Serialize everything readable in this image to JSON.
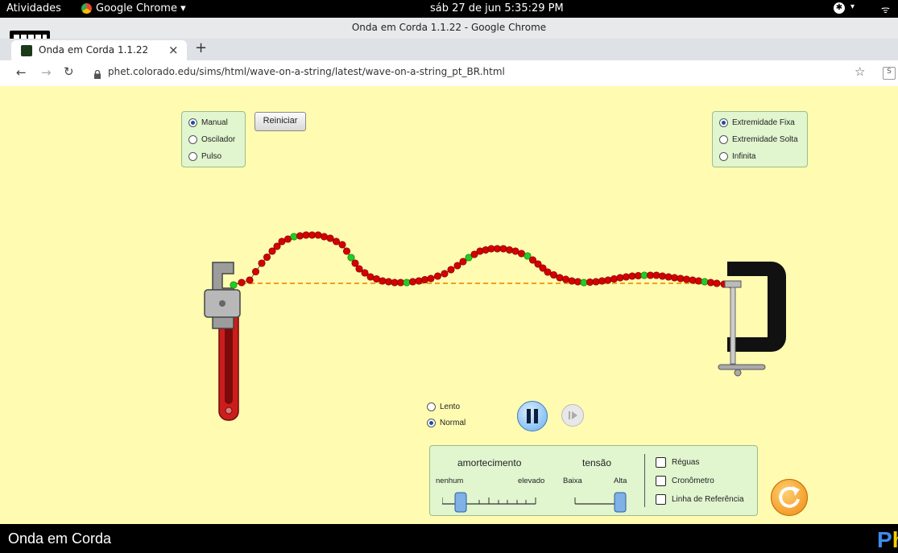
{
  "topbar": {
    "activities": "Atividades",
    "app_name": "Google Chrome ▾",
    "datetime": "sáb 27 de jun  5:35:29 PM",
    "accessibility_icon": "accessibility-icon",
    "network_icon": "wifi-icon"
  },
  "window": {
    "title": "Onda em Corda 1.1.22 - Google Chrome"
  },
  "tab": {
    "title": "Onda em Corda 1.1.22",
    "close": "×",
    "new_tab": "+"
  },
  "address": {
    "url": "phet.colorado.edu/sims/html/wave-on-a-string/latest/wave-on-a-string_pt_BR.html"
  },
  "sim": {
    "mode_options": [
      {
        "label": "Manual",
        "selected": true
      },
      {
        "label": "Oscilador",
        "selected": false
      },
      {
        "label": "Pulso",
        "selected": false
      }
    ],
    "reset_button": "Reiniciar",
    "end_options": [
      {
        "label": "Extremidade Fixa",
        "selected": true
      },
      {
        "label": "Extremidade Solta",
        "selected": false
      },
      {
        "label": "Infinita",
        "selected": false
      }
    ],
    "speed_options": [
      {
        "label": "Lento",
        "selected": false
      },
      {
        "label": "Normal",
        "selected": true
      }
    ],
    "damping": {
      "title": "amortecimento",
      "min_label": "nenhum",
      "max_label": "elevado",
      "value": 0.2
    },
    "tension": {
      "title": "tensão",
      "min_label": "Baixa",
      "max_label": "Alta",
      "value": 1.0
    },
    "checkboxes": [
      {
        "label": "Réguas",
        "checked": false
      },
      {
        "label": "Cronômetro",
        "checked": false
      },
      {
        "label": "Linha de Referência",
        "checked": false
      }
    ],
    "colors": {
      "background": "#fffbb1",
      "panel": "#e1f5cf",
      "bead": "#d40000",
      "bead_marker": "#22cc22",
      "reference_line": "#f0a020"
    }
  },
  "footer": {
    "title": "Onda em Corda",
    "logo": "PhET"
  }
}
